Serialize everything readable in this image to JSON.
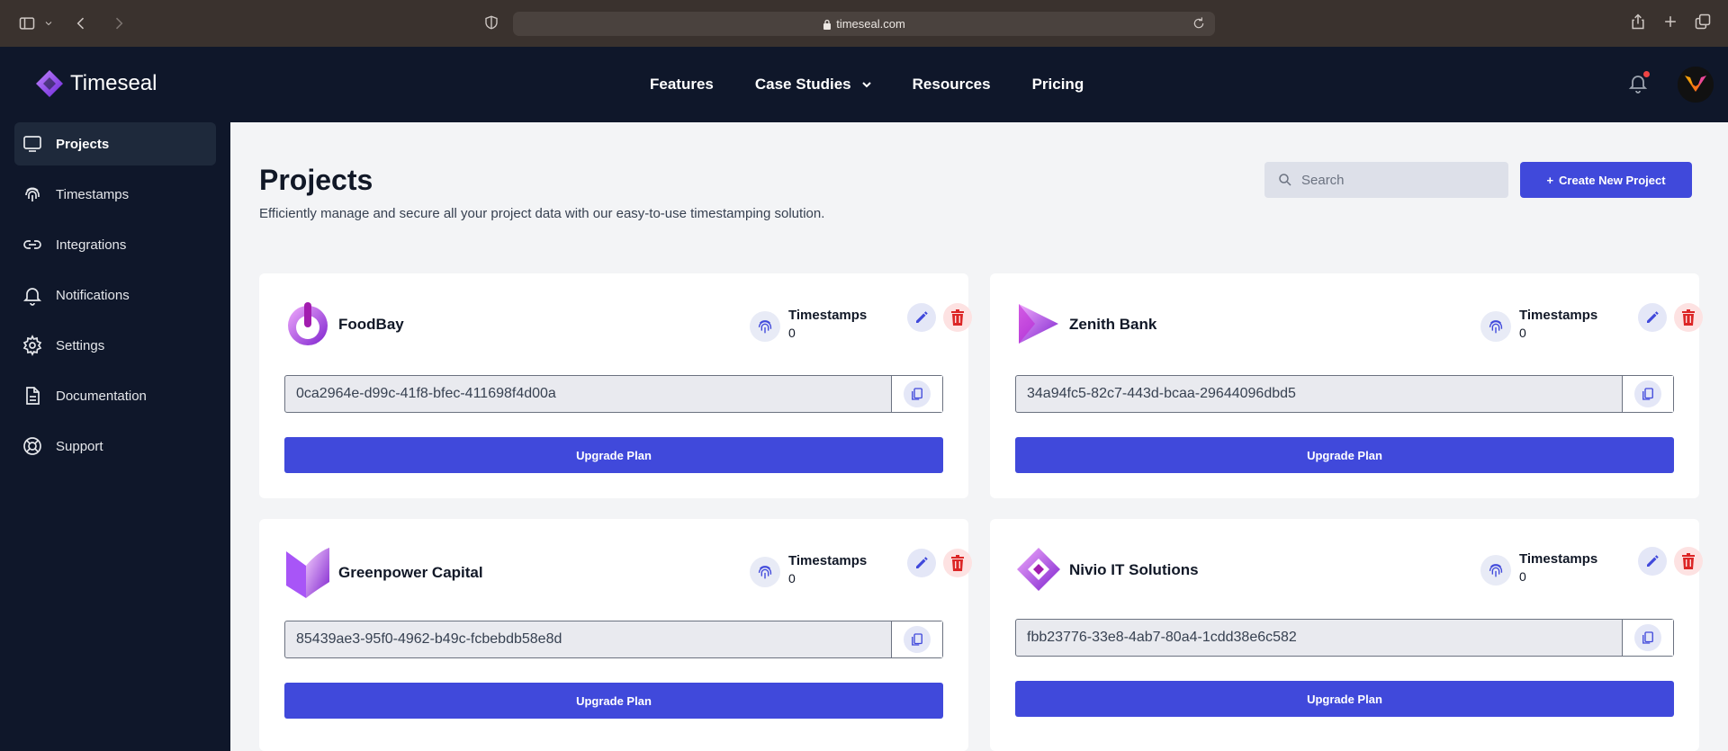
{
  "browser": {
    "url": "timeseal.com"
  },
  "header": {
    "brand": "Timeseal",
    "nav": [
      {
        "label": "Features"
      },
      {
        "label": "Case Studies"
      },
      {
        "label": "Resources"
      },
      {
        "label": "Pricing"
      }
    ]
  },
  "sidebar": {
    "items": [
      {
        "label": "Projects"
      },
      {
        "label": "Timestamps"
      },
      {
        "label": "Integrations"
      },
      {
        "label": "Notifications"
      },
      {
        "label": "Settings"
      },
      {
        "label": "Documentation"
      },
      {
        "label": "Support"
      }
    ]
  },
  "main": {
    "title": "Projects",
    "subtitle": "Efficiently manage and secure all your project data with our easy-to-use timestamping solution.",
    "search_placeholder": "Search",
    "create_label": "Create New Project",
    "timestamps_label": "Timestamps",
    "upgrade_label": "Upgrade Plan",
    "projects": [
      {
        "name": "FoodBay",
        "timestamps": "0",
        "key": "0ca2964e-d99c-41f8-bfec-411698f4d00a"
      },
      {
        "name": "Zenith Bank",
        "timestamps": "0",
        "key": "34a94fc5-82c7-443d-bcaa-29644096dbd5"
      },
      {
        "name": "Greenpower Capital",
        "timestamps": "0",
        "key": "85439ae3-95f0-4962-b49c-fcbebdb58e8d"
      },
      {
        "name": "Nivio IT Solutions",
        "timestamps": "0",
        "key": "fbb23776-33e8-4ab7-80a4-1cdd38e6c582"
      }
    ]
  },
  "colors": {
    "accent": "#4049db",
    "header_bg": "#0f172a",
    "danger": "#dc2626"
  }
}
